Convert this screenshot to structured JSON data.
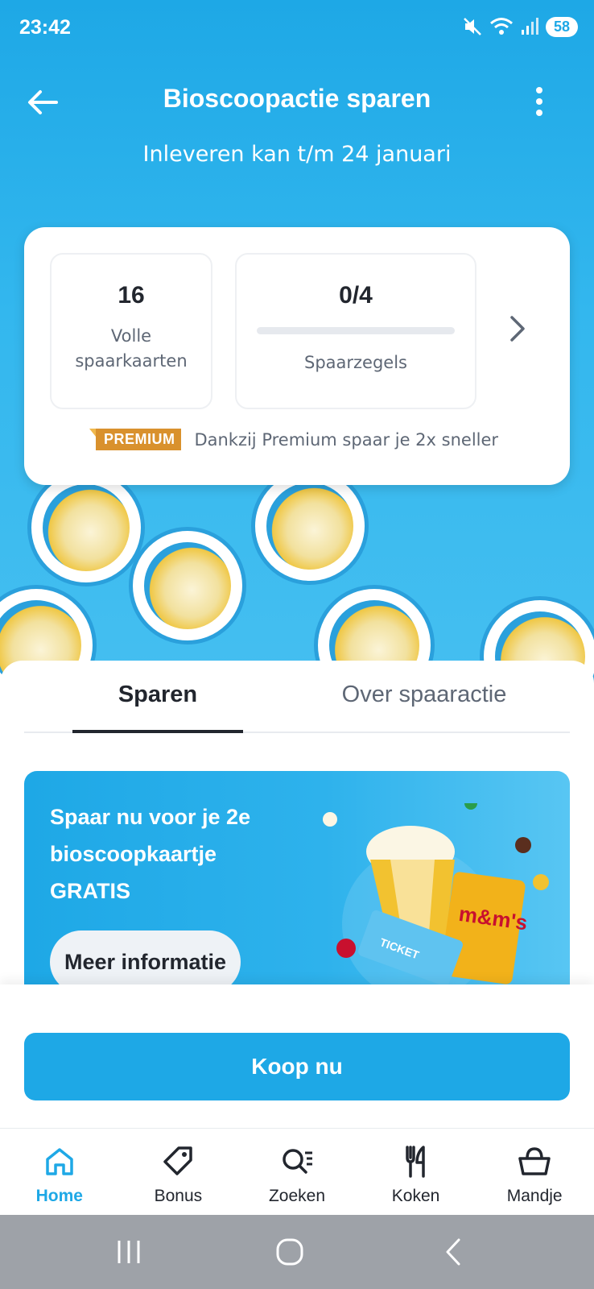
{
  "status_bar": {
    "time": "23:42",
    "battery": "58"
  },
  "header": {
    "title": "Bioscoopactie sparen",
    "subtitle": "Inleveren kan t/m 24 januari"
  },
  "stats": {
    "full_cards_value": "16",
    "full_cards_label_line1": "Volle",
    "full_cards_label_line2": "spaarkaarten",
    "stamps_value": "0/4",
    "stamps_label": "Spaarzegels",
    "stamps_progress_fraction": 0,
    "premium_badge": "PREMIUM",
    "premium_text": "Dankzij Premium spaar je 2x sneller"
  },
  "tabs": {
    "active": "Sparen",
    "inactive": "Over spaaractie"
  },
  "promo": {
    "line1": "Spaar nu voor je 2e",
    "line2": "bioscoopkaartje",
    "line3": "GRATIS",
    "button_label": "Meer informatie"
  },
  "buy_button": "Koop nu",
  "bottom_nav": [
    {
      "label": "Home",
      "icon": "home-icon",
      "active": true
    },
    {
      "label": "Bonus",
      "icon": "tag-icon",
      "active": false
    },
    {
      "label": "Zoeken",
      "icon": "search-icon",
      "active": false
    },
    {
      "label": "Koken",
      "icon": "cutlery-icon",
      "active": false
    },
    {
      "label": "Mandje",
      "icon": "basket-icon",
      "active": false
    }
  ],
  "colors": {
    "brand": "#1ea8e6",
    "premium": "#d9912d",
    "text": "#22262e"
  }
}
